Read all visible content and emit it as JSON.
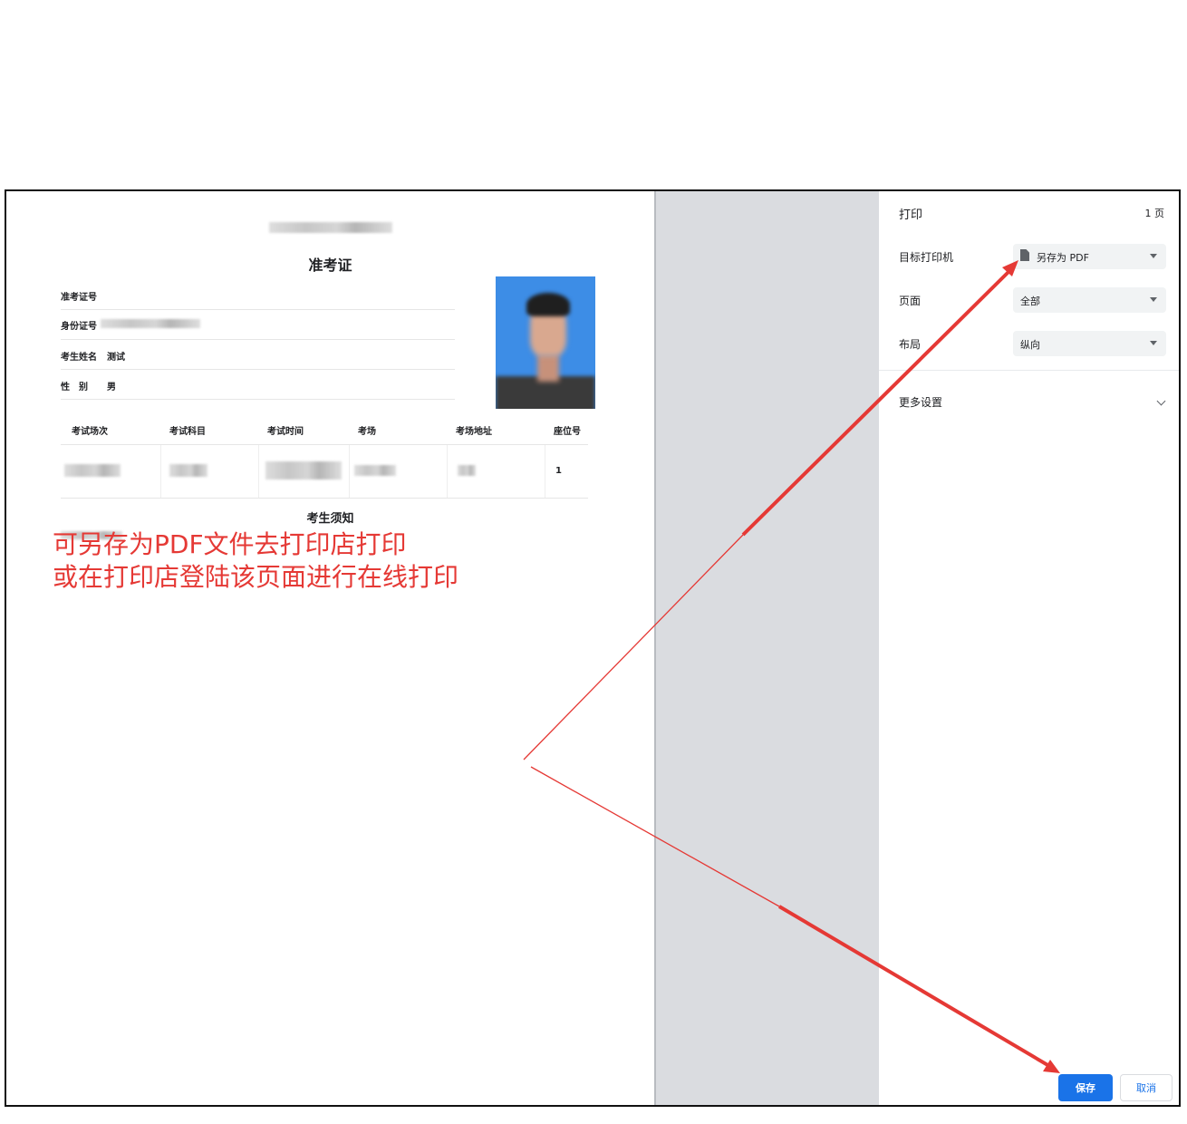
{
  "admit_card": {
    "title": "准考证",
    "fields": {
      "ticket_no_label": "准考证号",
      "id_no_label": "身份证号",
      "name_label": "考生姓名",
      "name_value": "测试",
      "gender_label": "性　别",
      "gender_value": "男"
    },
    "table": {
      "headers": [
        "考试场次",
        "考试科目",
        "考试时间",
        "考场",
        "考场地址",
        "座位号"
      ],
      "row": {
        "seat": "1"
      }
    },
    "notice_title": "考生须知"
  },
  "annotation": {
    "line1": "可另存为PDF文件去打印店打印",
    "line2": "或在打印店登陆该页面进行在线打印",
    "color": "#e53935"
  },
  "print_panel": {
    "title": "打印",
    "page_count": "1 页",
    "destination_label": "目标打印机",
    "destination_value": "另存为 PDF",
    "pages_label": "页面",
    "pages_value": "全部",
    "layout_label": "布局",
    "layout_value": "纵向",
    "more_settings_label": "更多设置",
    "save_label": "保存",
    "cancel_label": "取消",
    "accent_color": "#1a73e8"
  }
}
